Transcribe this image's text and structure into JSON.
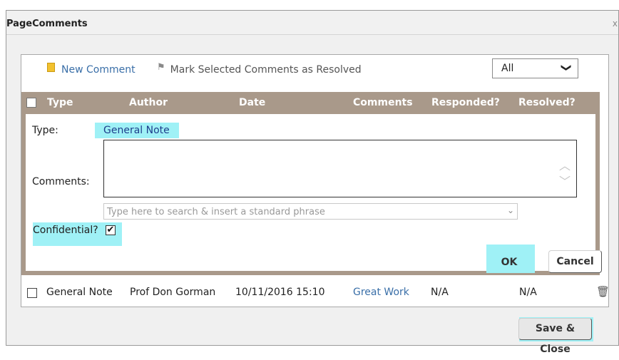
{
  "dialog": {
    "title": "PageComments",
    "close_glyph": "x"
  },
  "toolbar": {
    "new_comment_label": "New Comment",
    "mark_resolved_label": "Mark Selected Comments as Resolved",
    "filter": {
      "value": "All",
      "chevron": "❯"
    }
  },
  "table": {
    "headers": [
      "Type",
      "Author",
      "Date",
      "Comments",
      "Responded?",
      "Resolved?"
    ],
    "header_color": "#a9998a",
    "rows": [
      {
        "type": "General Note",
        "author": "Prof Don Gorman",
        "date": "10/11/2016 15:10",
        "comments": "Great Work",
        "responded": "N/A",
        "resolved": "N/A",
        "checked": false
      }
    ]
  },
  "form": {
    "type_label": "Type:",
    "type_value": "General Note",
    "comments_label": "Comments:",
    "comments_value": "",
    "phrase_placeholder": "Type here to search & insert a standard phrase",
    "confidential_label": "Confidential?",
    "confidential_checked": true,
    "check_glyph": "✔",
    "ok_label": "OK",
    "cancel_label": "Cancel"
  },
  "footer": {
    "save_close_label": "Save & Close"
  },
  "colors": {
    "highlight": "#9ff1f6",
    "link": "#3a6fa8"
  },
  "icons": {
    "new_comment": "note-icon",
    "mark_resolved": "flag-icon",
    "delete": "trash-icon"
  }
}
